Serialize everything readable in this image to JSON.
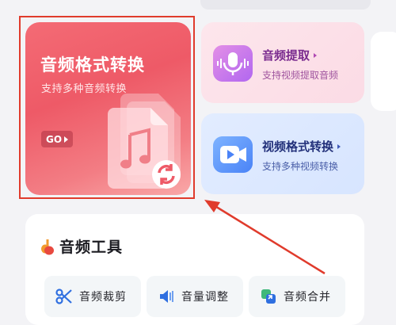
{
  "main_card": {
    "title": "音频格式转换",
    "subtitle": "支持多种音频转换",
    "go_label": "GO"
  },
  "extract_card": {
    "title": "音频提取",
    "subtitle": "支持视频提取音频"
  },
  "video_card": {
    "title": "视频格式转换",
    "subtitle": "支持多种视频转换"
  },
  "tools": {
    "heading": "音频工具",
    "items": [
      {
        "label": "音频裁剪",
        "icon": "scissors-icon"
      },
      {
        "label": "音量调整",
        "icon": "volume-icon"
      },
      {
        "label": "音频合并",
        "icon": "merge-icon"
      }
    ]
  },
  "colors": {
    "main_red": "#ee5a67",
    "highlight_red": "#e03b2c",
    "extract_purple": "#b167f0",
    "video_blue": "#4a83f7"
  }
}
